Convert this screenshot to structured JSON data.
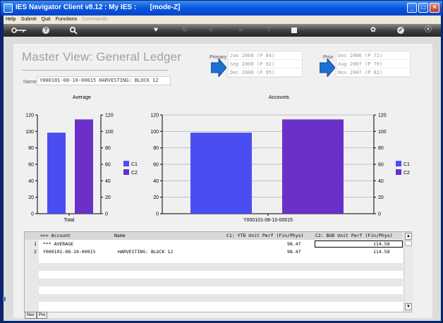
{
  "window": {
    "title": "IES Navigator Client v8.12 : My IES :       [mode-Z]",
    "controls": [
      "_",
      "□",
      "×"
    ]
  },
  "menu": {
    "items": [
      "Help",
      "Submit",
      "Quit",
      "Functions"
    ],
    "disabled_item": "Commands"
  },
  "toolbar": {
    "icons": [
      "key-icon",
      "help-icon",
      "search-icon",
      "heart-icon",
      "refresh-icon",
      "rewind-icon",
      "fast-forward-icon",
      "filter-icon",
      "stop-icon",
      "settings-icon",
      "check-icon",
      "close-icon"
    ]
  },
  "view": {
    "title": "Master View: General Ledger",
    "name_label": "Name",
    "name_value": "Y000101-08-10-00015 HARVESTING: BLOCK 12"
  },
  "primary": {
    "label": "Primary",
    "periods": [
      "Jan 2008 (P 84)",
      "Sep 2008 (P 92)",
      "Dec 2008 (P 95)"
    ]
  },
  "prior": {
    "label": "Prior",
    "periods": [
      "Dec 2006 (P 71)",
      "Aug 2007 (P 79)",
      "Nov 2007 (P 82)"
    ]
  },
  "chart_data": [
    {
      "type": "bar",
      "title": "Average",
      "categories": [
        "Total"
      ],
      "series": [
        {
          "name": "C1",
          "values": [
            98.47
          ],
          "color": "#4a4ef0"
        },
        {
          "name": "C2",
          "values": [
            114.58
          ],
          "color": "#6a30c8"
        }
      ],
      "ylim": [
        0,
        120
      ],
      "yticks": [
        "0",
        "20",
        "40",
        "60",
        "80",
        "100",
        "120"
      ],
      "grid": false,
      "legend": "right"
    },
    {
      "type": "bar",
      "title": "Accounts",
      "categories": [
        "Y000101-08-10-00015"
      ],
      "series": [
        {
          "name": "C1",
          "values": [
            98.47
          ],
          "color": "#4a4ef0"
        },
        {
          "name": "C2",
          "values": [
            114.58
          ],
          "color": "#6a30c8"
        }
      ],
      "ylim": [
        0,
        120
      ],
      "yticks": [
        "0",
        "20",
        "40",
        "60",
        "80",
        "100",
        "120"
      ],
      "grid": true,
      "legend": "right"
    }
  ],
  "grid": {
    "headers": [
      ">>> Account",
      "Name",
      "C1: YTD Unit Perf (Fin/Phys)",
      "C2: BUD Unit Perf (Fin/Phys)"
    ],
    "rows": [
      {
        "num": "1",
        "account": "*** AVERAGE",
        "name": "",
        "c1": "98.47",
        "c2": "114.58"
      },
      {
        "num": "2",
        "account": "Y000101-08-10-00015",
        "name": "HARVESTING: BLOCK 12",
        "c1": "98.47",
        "c2": "114.58"
      }
    ]
  },
  "nav": {
    "next": "Nex",
    "prev": "Pre"
  }
}
